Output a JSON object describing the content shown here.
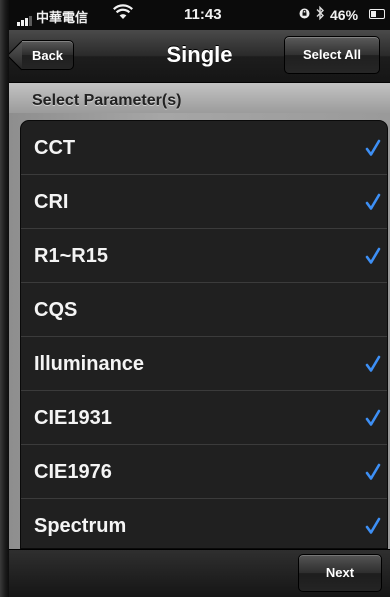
{
  "status_bar": {
    "carrier": "中華電信",
    "time": "11:43",
    "battery_percent": "46%",
    "battery_level": 0.46,
    "icons": [
      "signal-icon",
      "wifi-icon",
      "orientation-lock-icon",
      "bluetooth-icon",
      "battery-icon"
    ]
  },
  "nav": {
    "back_label": "Back",
    "title": "Single",
    "select_all_label": "Select All"
  },
  "section": {
    "title": "Select Parameter(s)"
  },
  "parameters": [
    {
      "label": "CCT",
      "checked": true
    },
    {
      "label": "CRI",
      "checked": true
    },
    {
      "label": "R1~R15",
      "checked": true
    },
    {
      "label": "CQS",
      "checked": false
    },
    {
      "label": "Illuminance",
      "checked": true
    },
    {
      "label": "CIE1931",
      "checked": true
    },
    {
      "label": "CIE1976",
      "checked": true
    },
    {
      "label": "Spectrum",
      "checked": true
    }
  ],
  "toolbar": {
    "next_label": "Next"
  },
  "colors": {
    "check": "#3d8ff5",
    "list_background": "#202020",
    "section_background": "#b4b4b4"
  }
}
